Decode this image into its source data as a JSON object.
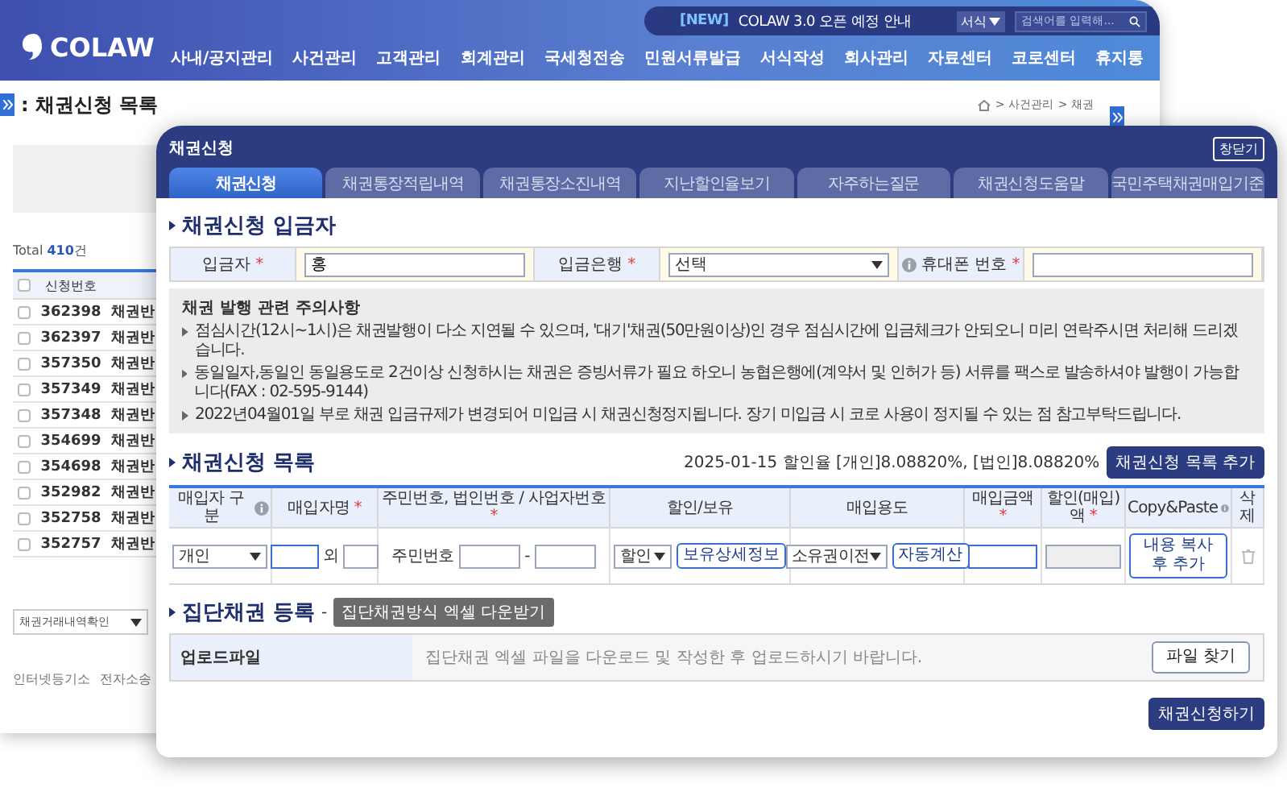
{
  "app": {
    "logo": "COLAW",
    "notice": {
      "badge": "[NEW]",
      "text": "COLAW 3.0 오픈 예정 안내"
    },
    "search": {
      "scope": "서식",
      "placeholder": "검색어를 입력해..."
    },
    "nav": [
      "사내/공지관리",
      "사건관리",
      "고객관리",
      "회계관리",
      "국세청전송",
      "민원서류발급",
      "서식작성",
      "회사관리",
      "자료센터",
      "코로센터",
      "휴지통"
    ],
    "page_title": ": 채권신청 목록",
    "breadcrumb": [
      "> 사건관리",
      "> 채권"
    ],
    "total": "Total **410**건",
    "table": {
      "all_checked": false,
      "columns": [
        "신청번호"
      ],
      "rows": [
        {
          "checked": false,
          "number": "362398",
          "column_3": "채권반"
        },
        {
          "checked": false,
          "number": "362397",
          "column_3": "채권반"
        },
        {
          "checked": false,
          "number": "357350",
          "column_3": "채권반"
        },
        {
          "checked": false,
          "number": "357349",
          "column_3": "채권반"
        },
        {
          "checked": false,
          "number": "357348",
          "column_3": "채권반"
        },
        {
          "checked": false,
          "number": "354699",
          "column_3": "채권반"
        },
        {
          "checked": false,
          "number": "354698",
          "column_3": "채권반"
        },
        {
          "checked": false,
          "number": "352982",
          "column_3": "채권반"
        },
        {
          "checked": false,
          "number": "352758",
          "column_3": "채권반"
        },
        {
          "checked": false,
          "number": "352757",
          "column_3": "채권반"
        }
      ]
    },
    "bottom_select": "채권거래내역확인",
    "footer_links": [
      "인터넷등기소",
      "전자소송"
    ]
  },
  "popup": {
    "title": "채권신청",
    "close_button": "창닫기",
    "tabs": [
      {
        "label": "채권신청",
        "selected": true
      },
      {
        "label": "채권통장적립내역",
        "selected": false
      },
      {
        "label": "채권통장소진내역",
        "selected": false
      },
      {
        "label": "지난할인율보기",
        "selected": false
      },
      {
        "label": "자주하는질문",
        "selected": false
      },
      {
        "label": "채권신청도움말",
        "selected": false
      },
      {
        "label": "국민주택채권매입기준",
        "selected": false
      }
    ],
    "depositor": {
      "title": "채권신청 입금자",
      "fields": [
        {
          "label": "입금자",
          "mark": "*",
          "kind": "text",
          "value": "홍"
        },
        {
          "label": "입금은행",
          "mark": "*",
          "kind": "select",
          "value": "선택"
        },
        {
          "label": "휴대폰 번호",
          "mark": "*",
          "kind": "text",
          "info": true
        }
      ]
    },
    "notice": {
      "title": "채권 발행 관련 주의사항",
      "items": [
        "점심시간(12시~1시)은 채권발행이 다소 지연될 수 있으며, '대기'채권(50만원이상)인 경우 점심시간에 입금체크가 안되오니 미리 연락주시면 처리해 드리겠습니다.",
        "동일일자,동일인 동일용도로 2건이상 신청하시는 채권은 증빙서류가 필요 하오니 농협은행에(계약서 및 인허가 등) 서류를 팩스로 발송하셔야 발행이 가능합니다(FAX : 02-595-9144)",
        "2022년04월01일 부로 채권 입금규제가 변경되어 미입금 시 채권신청정지됩니다. 장기 미입금 시 코로 사용이 정지될 수 있는 점 참고부탁드립니다."
      ]
    },
    "list": {
      "title": "채권신청 목록",
      "rate_info": "2025-01-15 할인율 [개인]8.08820%, [법인]8.08820%",
      "add_button": "채권신청 목록 추가",
      "columns": [
        {
          "label": "매입자 구분",
          "info": true
        },
        {
          "label": "매입자명",
          "mark": "*"
        },
        {
          "label": "주민번호, 법인번호 / 사업자번호",
          "mark": "*"
        },
        {
          "label": "할인/보유"
        },
        {
          "label": "매입용도"
        },
        {
          "label": "매입금액",
          "mark": "*"
        },
        {
          "label": "할인(매입)액",
          "mark": "*"
        },
        {
          "label": "Copy&Paste",
          "info": true
        },
        {
          "label": "삭제"
        }
      ],
      "row": {
        "buyer_type": "개인",
        "name_joiner": "외",
        "id_label": "주민번호",
        "id_dash": "-",
        "discount": "할인",
        "holding_button": "보유상세정보",
        "purpose": "소유권이전",
        "calc_button": "자동계산",
        "copy_button": "내용 복사 후 추가"
      }
    },
    "bulk": {
      "title": "집단채권 등록",
      "separator": "-",
      "download_button": "집단채권방식 엑셀 다운받기",
      "upload_label": "업로드파일",
      "upload_hint": "집단채권 엑셀 파일을 다운로드 및 작성한 후 업로드하시기 바랍니다.",
      "browse_button": "파일 찾기"
    },
    "submit_button": "채권신청하기"
  }
}
